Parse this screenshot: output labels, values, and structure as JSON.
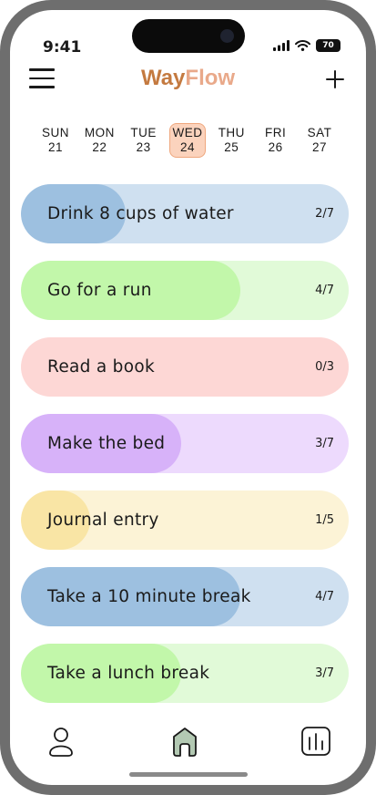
{
  "status_bar": {
    "time": "9:41",
    "battery": "70"
  },
  "header": {
    "title_part1": "Way",
    "title_part2": "Flow"
  },
  "days": [
    {
      "dow": "SUN",
      "date": "21",
      "active": false
    },
    {
      "dow": "MON",
      "date": "22",
      "active": false
    },
    {
      "dow": "TUE",
      "date": "23",
      "active": false
    },
    {
      "dow": "WED",
      "date": "24",
      "active": true
    },
    {
      "dow": "THU",
      "date": "25",
      "active": false
    },
    {
      "dow": "FRI",
      "date": "26",
      "active": false
    },
    {
      "dow": "SAT",
      "date": "27",
      "active": false
    }
  ],
  "habits": [
    {
      "name": "Drink 8 cups of water",
      "count": "2/7",
      "progress": 0.32,
      "bg": "#cfe0f0",
      "fill": "#9dc0e0"
    },
    {
      "name": "Go for a run",
      "count": "4/7",
      "progress": 0.67,
      "bg": "#e1fad8",
      "fill": "#c2f7aa"
    },
    {
      "name": "Read a book",
      "count": "0/3",
      "progress": 0.0,
      "bg": "#fdd7d5",
      "fill": "#fdd7d5"
    },
    {
      "name": "Make the bed",
      "count": "3/7",
      "progress": 0.49,
      "bg": "#eddafd",
      "fill": "#d7b2f9"
    },
    {
      "name": "Journal entry",
      "count": "1/5",
      "progress": 0.21,
      "bg": "#fcf3d6",
      "fill": "#f9e5a5"
    },
    {
      "name": "Take a 10 minute break",
      "count": "4/7",
      "progress": 0.67,
      "bg": "#cfe0f0",
      "fill": "#9dc0e0"
    },
    {
      "name": "Take a lunch break",
      "count": "3/7",
      "progress": 0.49,
      "bg": "#e1fad8",
      "fill": "#c2f7aa"
    }
  ],
  "tabs": [
    {
      "icon": "user-icon"
    },
    {
      "icon": "home-icon"
    },
    {
      "icon": "stats-icon"
    }
  ]
}
